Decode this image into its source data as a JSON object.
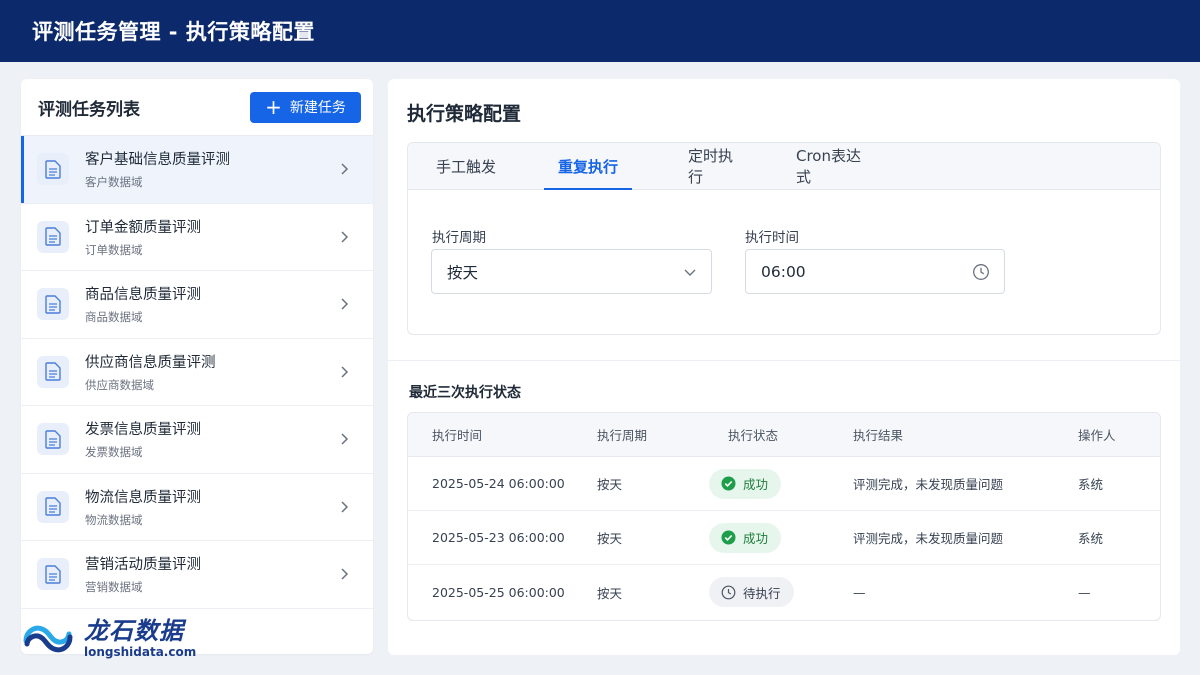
{
  "header": {
    "title": "评测任务管理 - 执行策略配置"
  },
  "sidebar": {
    "title": "评测任务列表",
    "new_button_label": "新建任务",
    "items": [
      {
        "name": "客户基础信息质量评测",
        "domain": "客户数据域",
        "active": true
      },
      {
        "name": "订单金额质量评测",
        "domain": "订单数据域"
      },
      {
        "name": "商品信息质量评测",
        "domain": "商品数据域"
      },
      {
        "name": "供应商信息质量评测",
        "domain": "供应商数据域"
      },
      {
        "name": "发票信息质量评测",
        "domain": "发票数据域"
      },
      {
        "name": "物流信息质量评测",
        "domain": "物流数据域"
      },
      {
        "name": "营销活动质量评测",
        "domain": "营销数据域"
      }
    ]
  },
  "logo": {
    "cn": "龙石数据",
    "en": "longshidata.com"
  },
  "main": {
    "title": "执行策略配置",
    "tabs": [
      {
        "label": "手工触发"
      },
      {
        "label": "重复执行",
        "active": true
      },
      {
        "label": "定时执行"
      },
      {
        "label": "Cron表达式"
      }
    ],
    "form": {
      "period_label": "执行周期",
      "period_value": "按天",
      "time_label": "执行时间",
      "time_value": "06:00"
    },
    "recent": {
      "title": "最近三次执行状态",
      "columns": [
        "执行时间",
        "执行周期",
        "执行状态",
        "执行结果",
        "操作人"
      ],
      "rows": [
        {
          "time": "2025-05-24 06:00:00",
          "period": "按天",
          "status": "成功",
          "status_type": "success",
          "result": "评测完成，未发现质量问题",
          "operator": "系统"
        },
        {
          "time": "2025-05-23 06:00:00",
          "period": "按天",
          "status": "成功",
          "status_type": "success",
          "result": "评测完成，未发现质量问题",
          "operator": "系统"
        },
        {
          "time": "2025-05-25 06:00:00",
          "period": "按天",
          "status": "待执行",
          "status_type": "pending",
          "result": "—",
          "operator": "—"
        }
      ]
    }
  },
  "colors": {
    "primary": "#1665e6",
    "header_bg": "#0c2a6b",
    "success": "#1e9e4a"
  }
}
